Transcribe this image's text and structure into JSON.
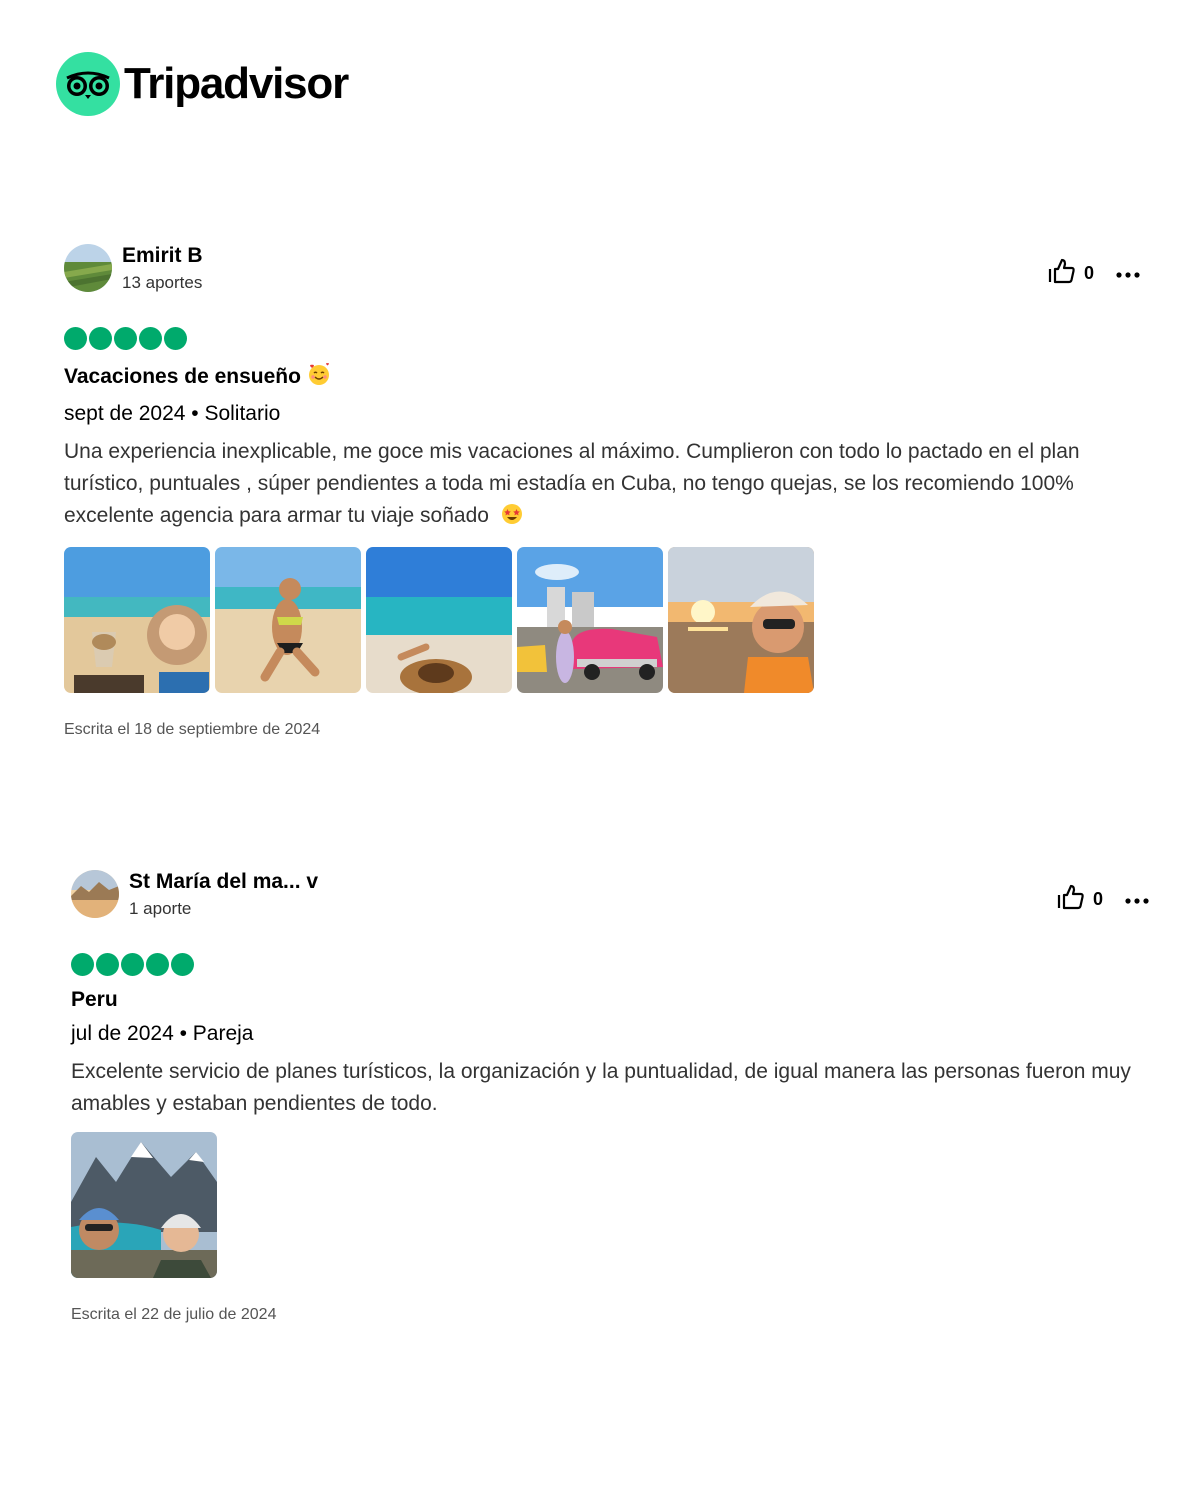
{
  "brand": {
    "name": "Tripadvisor",
    "color": "#34e0a1",
    "icon": "owl-eyes-logo"
  },
  "colors": {
    "rating_bubble": "#00aa6c"
  },
  "reviews": [
    {
      "user_name": "Emirit B",
      "contributions": "13 aportes",
      "likes": "0",
      "rating": 5,
      "title": "Vacaciones de ensueño",
      "title_emoji": "smiling-face-with-hearts",
      "date_type": "sept de 2024 • Solitario",
      "text": "Una experiencia inexplicable, me goce mis vacaciones al máximo. Cumplieron con todo lo pactado en el plan turístico, puntuales , súper pendientes a toda mi estadía en Cuba, no tengo quejas, se los recomiendo 100% excelente agencia para armar tu viaje soñado",
      "text_emoji": "star-struck",
      "photos": [
        "beach-drink-photo",
        "beach-posing-photo",
        "sea-hat-photo",
        "pink-classic-car-photo",
        "sunset-selfie-photo"
      ],
      "written": "Escrita el 18 de septiembre de 2024"
    },
    {
      "user_name": "St María del ma... v",
      "contributions": "1 aporte",
      "likes": "0",
      "rating": 5,
      "title": "Peru",
      "date_type": "jul de 2024 • Pareja",
      "text": "Excelente servicio de planes turísticos, la organización y la puntualidad, de igual manera las personas fueron muy amables y estaban pendientes de todo.",
      "photos": [
        "mountain-lake-selfie-photo"
      ],
      "written": "Escrita el 22 de julio de 2024"
    }
  ]
}
